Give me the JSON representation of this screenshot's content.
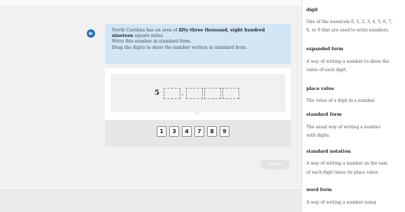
{
  "problem": {
    "prompt_intro": "North Carolina has an area of ",
    "prompt_bold": "fifty-three thousand, eight hundred nineteen",
    "prompt_after": " square miles.",
    "instruction_1": "Write this number in standard form.",
    "instruction_2": "Drag the digits to show the number written in standard form.",
    "lead_digit": "5",
    "separator": ",",
    "submit_label": "Submit"
  },
  "tiles": [
    "1",
    "3",
    "4",
    "7",
    "8",
    "9"
  ],
  "glossary": [
    {
      "term": "digit",
      "def_lines": [
        "One of the numerals 0, 1, 2, 3, 4, 5, 6, 7,",
        "8, or 9 that are used to write numbers."
      ]
    },
    {
      "term": "expanded form",
      "def_lines": [
        "A way of writing a number to show the",
        "value of each digit."
      ]
    },
    {
      "term": "place value",
      "def_lines": [
        "The value of a digit in a number."
      ]
    },
    {
      "term": "standard form",
      "def_lines": [
        "The usual way of writing a number",
        "with digits."
      ]
    },
    {
      "term": "standard notation",
      "def_lines": [
        "A way of writing a number as the sum",
        "of each digit times its place value."
      ]
    },
    {
      "term": "word form",
      "def_lines": [
        "A way of writing a number using"
      ]
    }
  ],
  "colors": {
    "accent": "#2b73b8",
    "prompt_bg": "#d3e6f5"
  },
  "icons": {
    "audio": "speaker-icon"
  }
}
